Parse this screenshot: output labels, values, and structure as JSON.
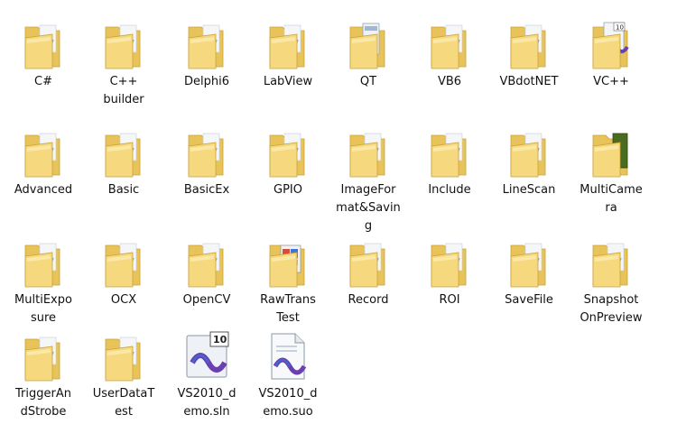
{
  "colors": {
    "folder_back": "#e8c35a",
    "folder_front": "#f6d97f",
    "folder_light": "#fbe9a8",
    "paper": "#f4f6f8",
    "vs_purple": "#6a3fb0",
    "vs_blue": "#2f7be0",
    "caption_red": "#c00000"
  },
  "caption": "",
  "items": [
    {
      "label": "C#",
      "icon": "folder-icon"
    },
    {
      "label": "C++\nbuilder",
      "icon": "folder-icon"
    },
    {
      "label": "Delphi6",
      "icon": "folder-icon"
    },
    {
      "label": "LabView",
      "icon": "folder-icon"
    },
    {
      "label": "QT",
      "icon": "folder-with-file-icon"
    },
    {
      "label": "VB6",
      "icon": "folder-icon"
    },
    {
      "label": "VBdotNET",
      "icon": "folder-icon"
    },
    {
      "label": "VC++",
      "icon": "folder-with-vs-icon"
    },
    {
      "label": "Advanced",
      "icon": "folder-icon"
    },
    {
      "label": "Basic",
      "icon": "folder-icon"
    },
    {
      "label": "BasicEx",
      "icon": "folder-icon"
    },
    {
      "label": "GPIO",
      "icon": "folder-icon"
    },
    {
      "label": "ImageFor\nmat&Savin\ng",
      "icon": "folder-icon"
    },
    {
      "label": "Include",
      "icon": "folder-icon"
    },
    {
      "label": "LineScan",
      "icon": "folder-icon"
    },
    {
      "label": "MultiCame\nra",
      "icon": "folder-with-green-doc-icon"
    },
    {
      "label": "MultiExpo\nsure",
      "icon": "folder-icon"
    },
    {
      "label": "OCX",
      "icon": "folder-icon"
    },
    {
      "label": "OpenCV",
      "icon": "folder-icon"
    },
    {
      "label": "RawTrans\nTest",
      "icon": "folder-with-app-icon"
    },
    {
      "label": "Record",
      "icon": "folder-icon"
    },
    {
      "label": "ROI",
      "icon": "folder-icon"
    },
    {
      "label": "SaveFile",
      "icon": "folder-icon"
    },
    {
      "label": "Snapshot\nOnPreview",
      "icon": "folder-icon"
    },
    {
      "label": "TriggerAn\ndStrobe",
      "icon": "folder-icon"
    },
    {
      "label": "UserDataT\nest",
      "icon": "folder-icon"
    },
    {
      "label": "VS2010_d\nemo.sln",
      "icon": "vs-solution-icon"
    },
    {
      "label": "VS2010_d\nemo.suo",
      "icon": "vs-suo-file-icon"
    }
  ]
}
